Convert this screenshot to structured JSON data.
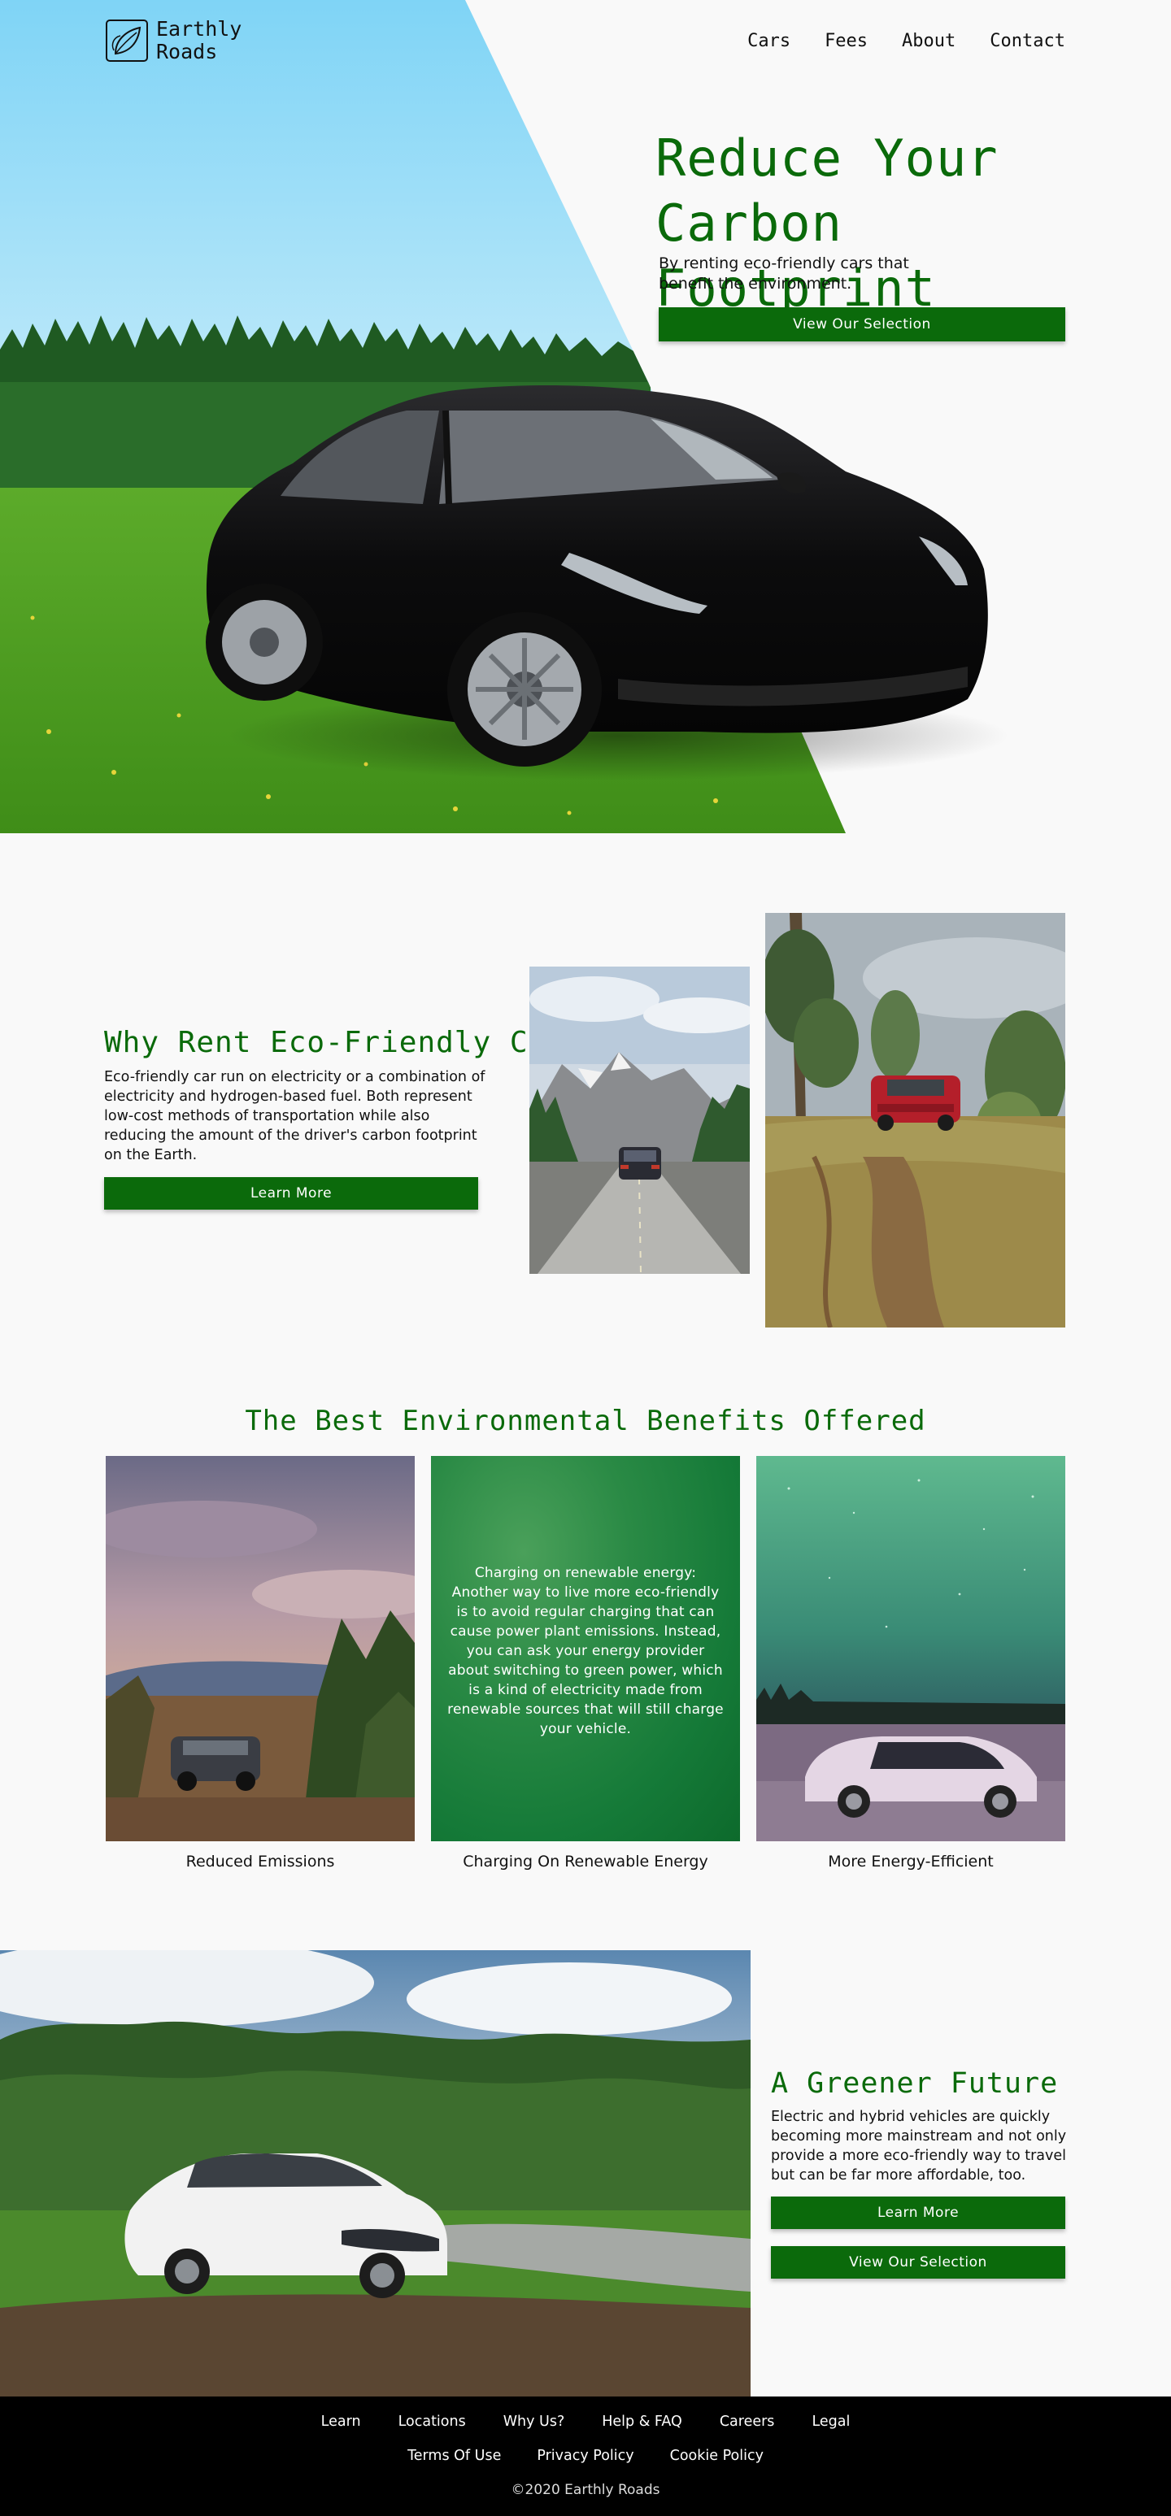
{
  "brand": {
    "line1": "Earthly",
    "line2": "Roads",
    "logo_icon": "leaf-square-icon"
  },
  "nav": [
    {
      "label": "Cars"
    },
    {
      "label": "Fees"
    },
    {
      "label": "About"
    },
    {
      "label": "Contact"
    }
  ],
  "hero": {
    "title_line1": "Reduce Your",
    "title_line2": "Carbon Footprint",
    "subtitle": "By renting eco-friendly cars that benefit the environment.",
    "cta": "View Our Selection"
  },
  "why": {
    "title": "Why Rent Eco-Friendly Cars?",
    "body": "Eco-friendly car run on electricity or a combination of electricity and hydrogen-based fuel. Both represent low-cost methods of transportation while also reducing the amount of the driver's carbon footprint on the Earth.",
    "cta": "Learn More"
  },
  "benefits": {
    "title": "The Best Environmental Benefits Offered",
    "items": [
      {
        "caption": "Reduced Emissions"
      },
      {
        "caption": "Charging On Renewable Energy",
        "overlay": "Charging on renewable energy: Another way to live more eco-friendly is to avoid regular charging that can cause power plant emissions. Instead, you can ask your energy provider about switching to green power, which is a kind of electricity made from renewable sources that will still charge your vehicle."
      },
      {
        "caption": "More Energy-Efficient"
      }
    ]
  },
  "future": {
    "title": "A Greener Future",
    "body": "Electric and hybrid vehicles are quickly becoming more mainstream and not only provide a more eco-friendly way to travel but can be far more affordable, too.",
    "cta_primary": "Learn More",
    "cta_secondary": "View Our Selection"
  },
  "footer": {
    "row1": [
      "Learn",
      "Locations",
      "Why Us?",
      "Help & FAQ",
      "Careers",
      "Legal"
    ],
    "row2": [
      "Terms Of Use",
      "Privacy Policy",
      "Cookie Policy"
    ],
    "copyright": "©2020 Earthly Roads"
  },
  "colors": {
    "accent": "#0b6a0b",
    "title_green": "#0a6a0a",
    "footer_bg": "#000000",
    "page_bg": "#f9f9f9"
  }
}
